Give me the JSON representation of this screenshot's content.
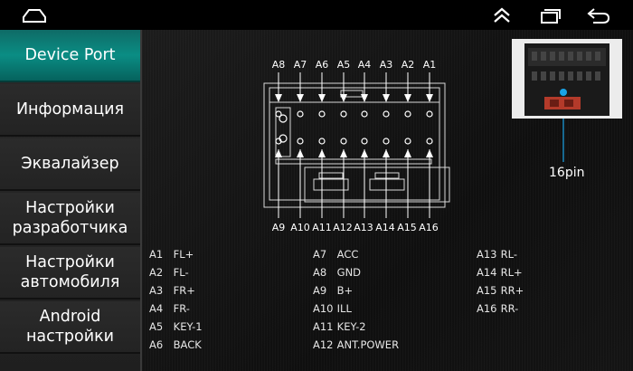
{
  "menu": [
    {
      "label": "Device Port",
      "active": true
    },
    {
      "label": "Информация"
    },
    {
      "label": "Эквалайзер"
    },
    {
      "label": "Настройки\nразработчика"
    },
    {
      "label": "Настройки\nавтомобиля"
    },
    {
      "label": "Android\nнастройки"
    }
  ],
  "top_pins": [
    "A8",
    "A7",
    "A6",
    "A5",
    "A4",
    "A3",
    "A2",
    "A1"
  ],
  "bottom_pins": [
    "A9",
    "A10",
    "A11",
    "A12",
    "A13",
    "A14",
    "A15",
    "A16"
  ],
  "pin_count": "16pin",
  "legend": [
    {
      "code": "A1",
      "name": "FL+"
    },
    {
      "code": "A2",
      "name": "FL-"
    },
    {
      "code": "A3",
      "name": "FR+"
    },
    {
      "code": "A4",
      "name": "FR-"
    },
    {
      "code": "A5",
      "name": "KEY-1"
    },
    {
      "code": "A6",
      "name": "BACK"
    },
    {
      "code": "A7",
      "name": "ACC"
    },
    {
      "code": "A8",
      "name": "GND"
    },
    {
      "code": "A9",
      "name": "B+"
    },
    {
      "code": "A10",
      "name": "ILL"
    },
    {
      "code": "A11",
      "name": "KEY-2"
    },
    {
      "code": "A12",
      "name": "ANT.POWER"
    },
    {
      "code": "A13",
      "name": "RL-"
    },
    {
      "code": "A14",
      "name": "RL+"
    },
    {
      "code": "A15",
      "name": "RR+"
    },
    {
      "code": "A16",
      "name": "RR-"
    }
  ],
  "icons": {
    "home": "home-icon",
    "collapse": "double-chevron-up-icon",
    "recent": "recent-apps-icon",
    "back": "back-arrow-icon"
  },
  "colors": {
    "accent": "#0a8d84",
    "photo_marker": "#1aa3e6"
  }
}
